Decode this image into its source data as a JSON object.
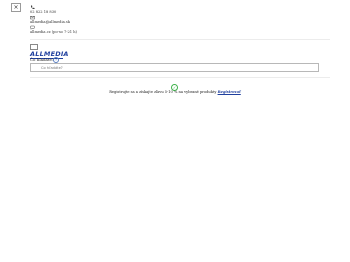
{
  "window": {
    "close_symbol": "×"
  },
  "contact": {
    "phone": "02 822 18 830",
    "email": "allmedia@allmedia.sk",
    "hours": "allmedia.cz (po-so 7-21 h)",
    "icons": {
      "phone": "phone-icon",
      "email": "envelope-icon",
      "chat": "chat-icon"
    }
  },
  "brand": {
    "logo_text": "ALLMEDIA"
  },
  "search": {
    "label": "Čo hľadáte?",
    "placeholder": "Čo hľadáte?",
    "help_symbol": "?"
  },
  "promo": {
    "icon": "check-circle-icon",
    "text": "Registrujte sa a získajte zľavu 5-10 % na vybrané produkty",
    "link": "Registrovať"
  },
  "colors": {
    "brand": "#1f3f9e",
    "success": "#3db24a",
    "border": "#b8b8b8"
  }
}
